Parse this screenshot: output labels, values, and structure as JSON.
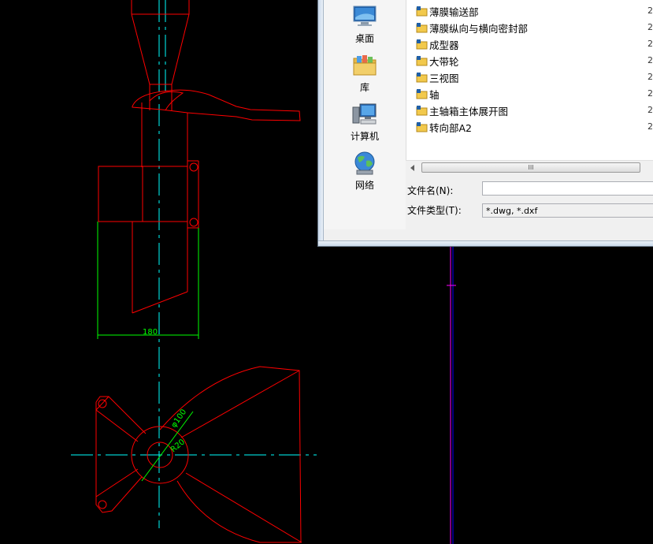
{
  "places": [
    {
      "label": "桌面",
      "icon": "desktop-icon"
    },
    {
      "label": "库",
      "icon": "library-icon"
    },
    {
      "label": "计算机",
      "icon": "computer-icon"
    },
    {
      "label": "网络",
      "icon": "network-icon"
    }
  ],
  "files": [
    {
      "name": "薄膜输送部",
      "date": "2"
    },
    {
      "name": "薄膜纵向与横向密封部",
      "date": "2"
    },
    {
      "name": "成型器",
      "date": "2"
    },
    {
      "name": "大带轮",
      "date": "2"
    },
    {
      "name": "三视图",
      "date": "2"
    },
    {
      "name": "轴",
      "date": "2"
    },
    {
      "name": "主轴箱主体展开图",
      "date": "2"
    },
    {
      "name": "转向部A2",
      "date": "2"
    }
  ],
  "scrollbar": {
    "thumb_grip": "III"
  },
  "filename": {
    "label": "文件名(N):",
    "value": ""
  },
  "filetype": {
    "label": "文件类型(T):",
    "value": "*.dwg, *.dxf"
  },
  "drawing": {
    "dimension_width": "180",
    "dimension_diameter": "φ100",
    "dimension_radius": "R20"
  },
  "colors": {
    "outline": "#ff0000",
    "centerline": "#00ffff",
    "dimension": "#00ff00",
    "magenta_line": "#ff00ff",
    "blue_line": "#0000ff"
  }
}
